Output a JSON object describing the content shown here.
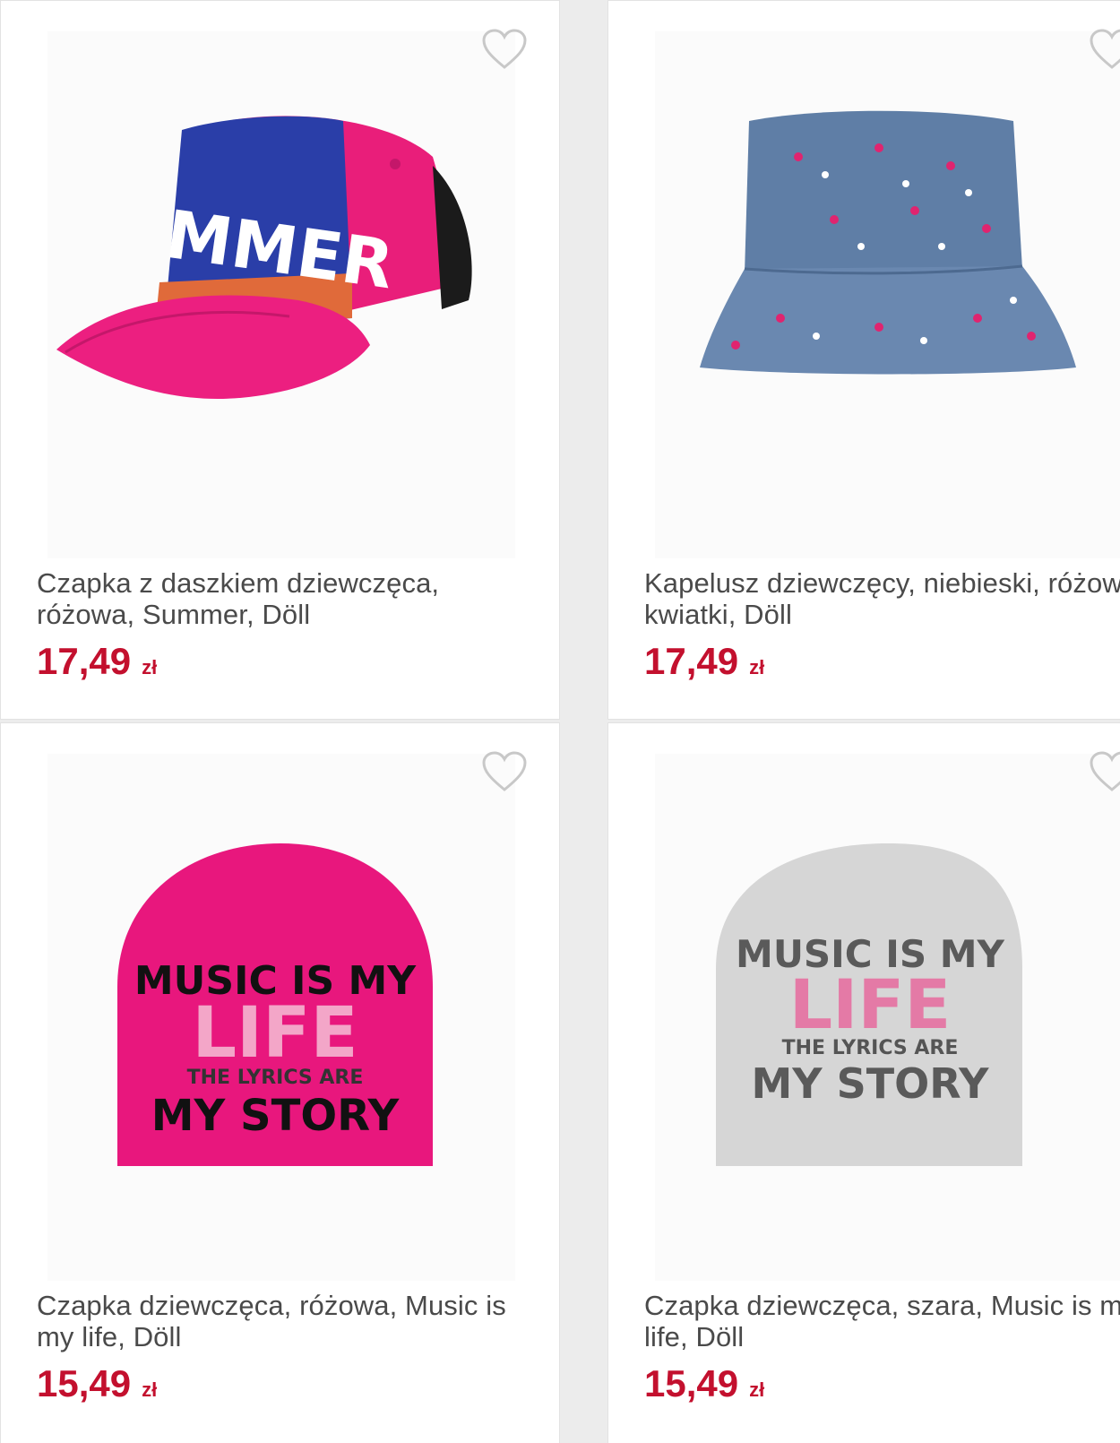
{
  "products": [
    {
      "title": "Czapka z daszkiem dziewczęca, różowa, Summer, Döll",
      "price": "17,49",
      "currency": "zł",
      "image": "pink-baseball-cap",
      "print_text": "MMER"
    },
    {
      "title": "Kapelusz dziewczęcy, niebieski, różowe kwiatki, Döll",
      "price": "17,49",
      "currency": "zł",
      "image": "blue-floral-bucket-hat"
    },
    {
      "title": "Czapka dziewczęca, różowa, Music is my life, Döll",
      "price": "15,49",
      "currency": "zł",
      "image": "pink-beanie",
      "print_lines": [
        "MUSIC IS MY",
        "LIFE",
        "THE LYRICS ARE",
        "MY STORY"
      ]
    },
    {
      "title": "Czapka dziewczęca, szara, Music is my life, Döll",
      "price": "15,49",
      "currency": "zł",
      "image": "grey-beanie",
      "print_lines": [
        "MUSIC IS MY",
        "LIFE",
        "THE LYRICS ARE",
        "MY STORY"
      ]
    }
  ],
  "colors": {
    "price": "#c3102e",
    "title": "#4a4a4a",
    "heart_outline": "#c8c8c8"
  },
  "icons": {
    "wishlist": "heart-outline-icon"
  }
}
